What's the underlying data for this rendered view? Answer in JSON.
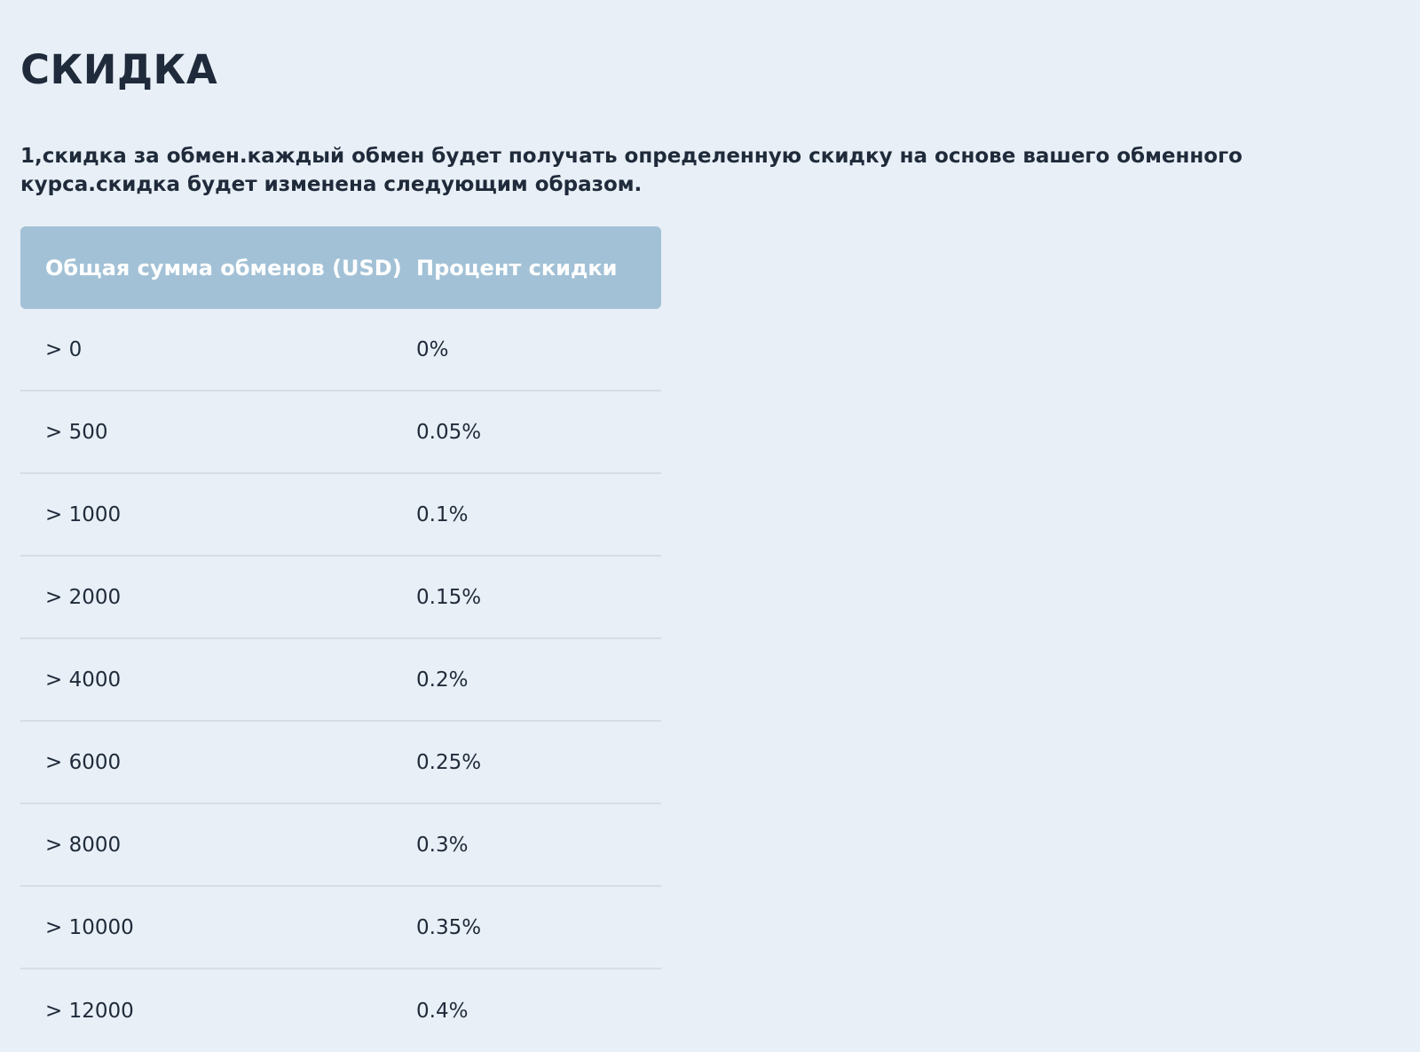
{
  "page": {
    "title": "СКИДКА",
    "intro": "1,скидка за обмен.каждый обмен будет получать определенную скидку на основе вашего обменного курса.скидка будет изменена следующим образом."
  },
  "table": {
    "headers": [
      "Общая сумма обменов (USD)",
      "Процент скидки"
    ],
    "rows": [
      {
        "amount": "> 0",
        "percent": "0%"
      },
      {
        "amount": "> 500",
        "percent": "0.05%"
      },
      {
        "amount": "> 1000",
        "percent": "0.1%"
      },
      {
        "amount": "> 2000",
        "percent": "0.15%"
      },
      {
        "amount": "> 4000",
        "percent": "0.2%"
      },
      {
        "amount": "> 6000",
        "percent": "0.25%"
      },
      {
        "amount": "> 8000",
        "percent": "0.3%"
      },
      {
        "amount": "> 10000",
        "percent": "0.35%"
      },
      {
        "amount": "> 12000",
        "percent": "0.4%"
      }
    ]
  },
  "colors": {
    "background": "#e8eff6",
    "header_bg": "#a2c1d6",
    "text": "#1f2a3a",
    "row_divider": "#d5dde6"
  }
}
